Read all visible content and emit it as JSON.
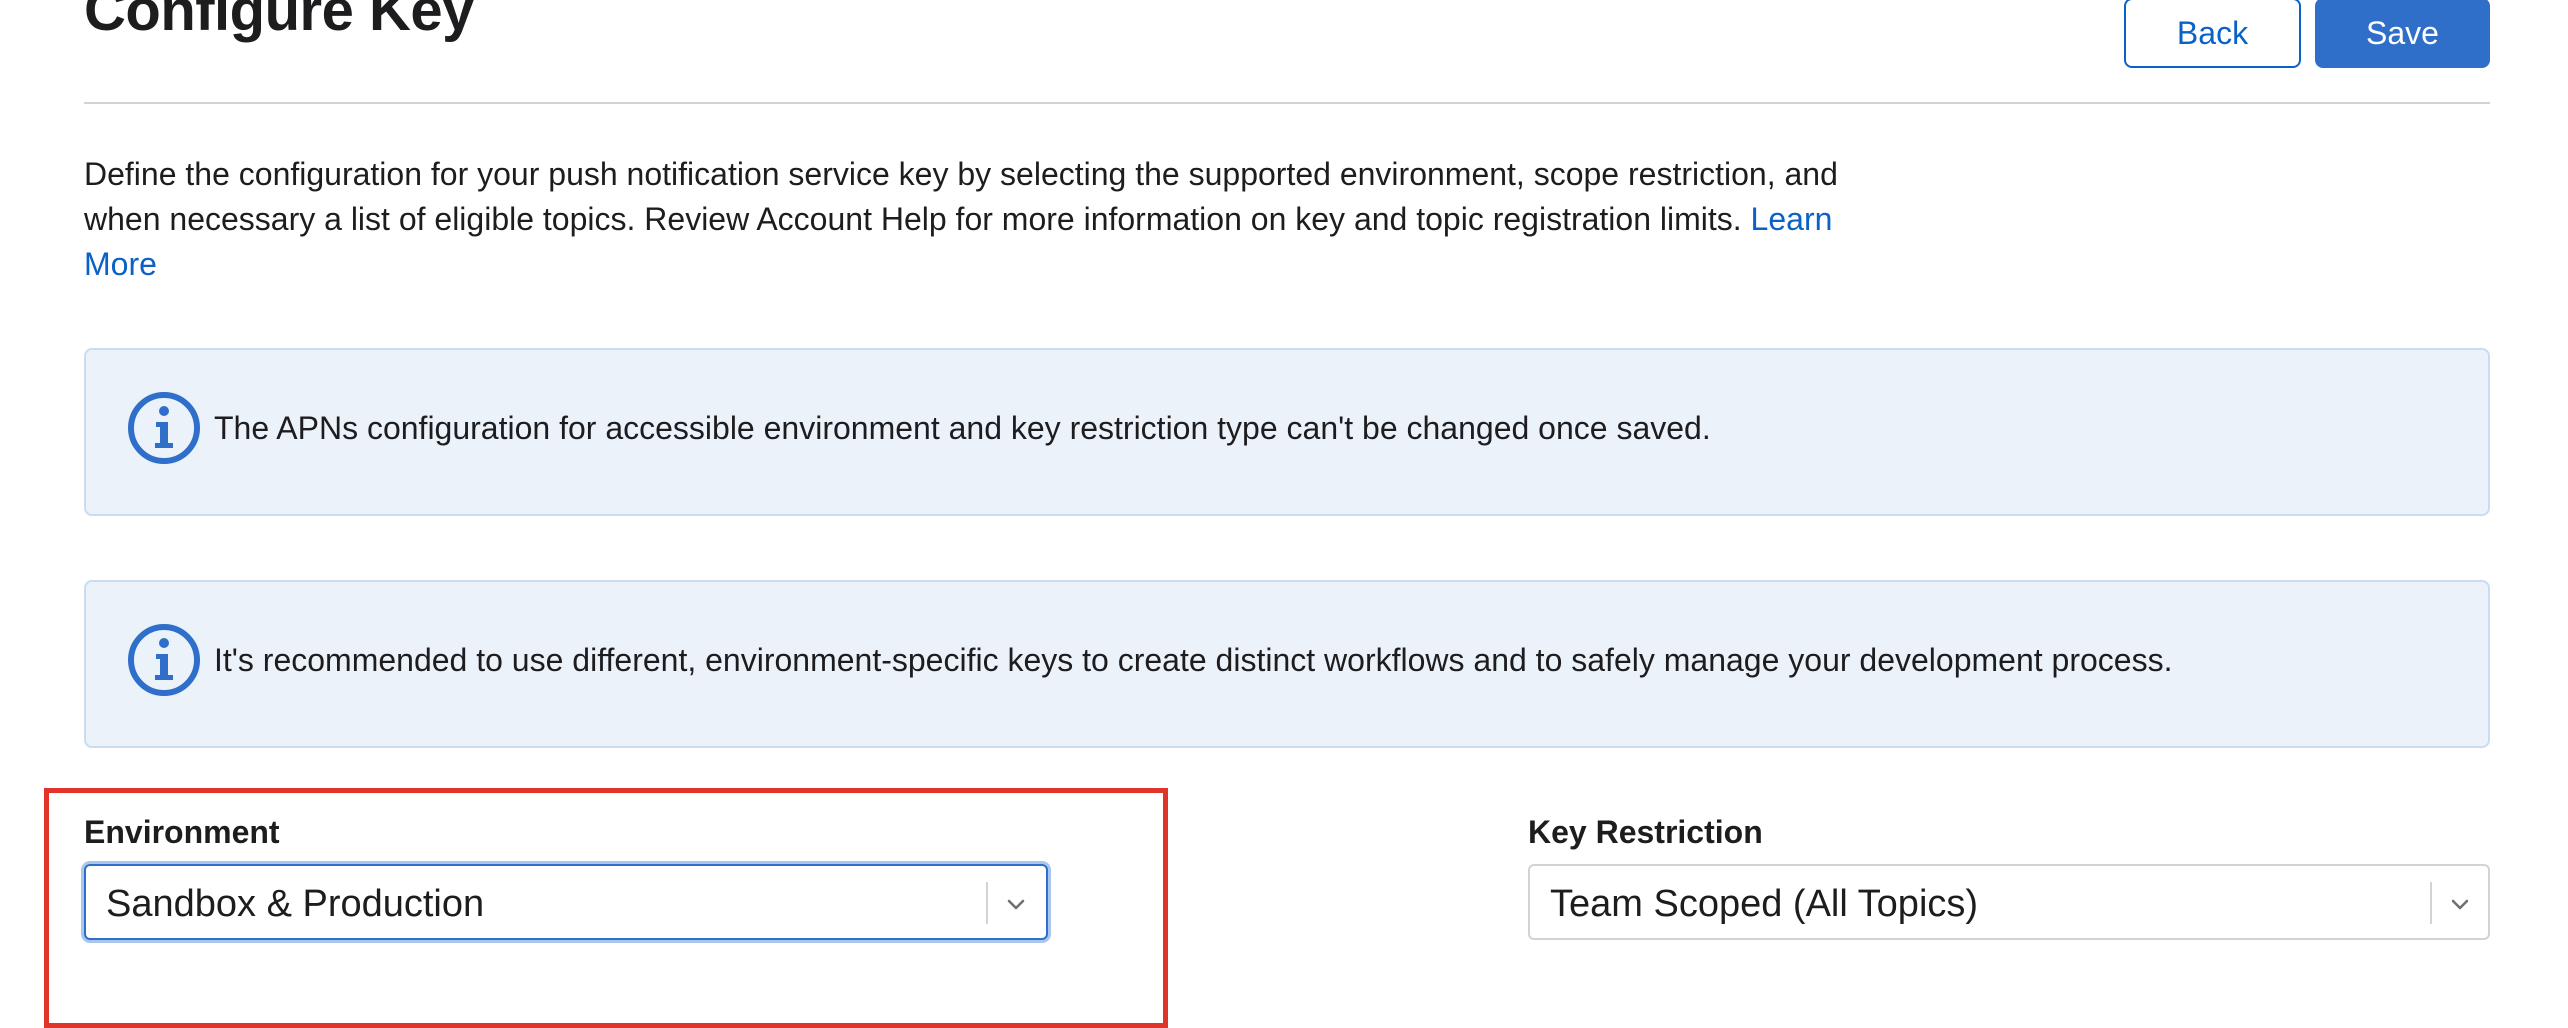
{
  "header": {
    "title": "Configure Key",
    "back_label": "Back",
    "save_label": "Save"
  },
  "description": {
    "text": "Define the configuration for your push notification service key by selecting the supported environment, scope restriction, and when necessary a list of eligible topics. Review Account Help for more information on key and topic registration limits. ",
    "link_label": "Learn More"
  },
  "notices": [
    {
      "icon": "info-icon",
      "text": "The APNs configuration for accessible environment and key restriction type can't be changed once saved."
    },
    {
      "icon": "info-icon",
      "text": "It's recommended to use different, environment-specific keys to create distinct workflows and to safely manage your development process."
    }
  ],
  "fields": {
    "environment": {
      "label": "Environment",
      "value": "Sandbox & Production"
    },
    "key_restriction": {
      "label": "Key Restriction",
      "value": "Team Scoped (All Topics)"
    }
  },
  "colors": {
    "accent": "#0b62c6",
    "primary_button": "#2f6fca",
    "notice_background": "#ebf2fa",
    "highlight": "#e0332a"
  }
}
